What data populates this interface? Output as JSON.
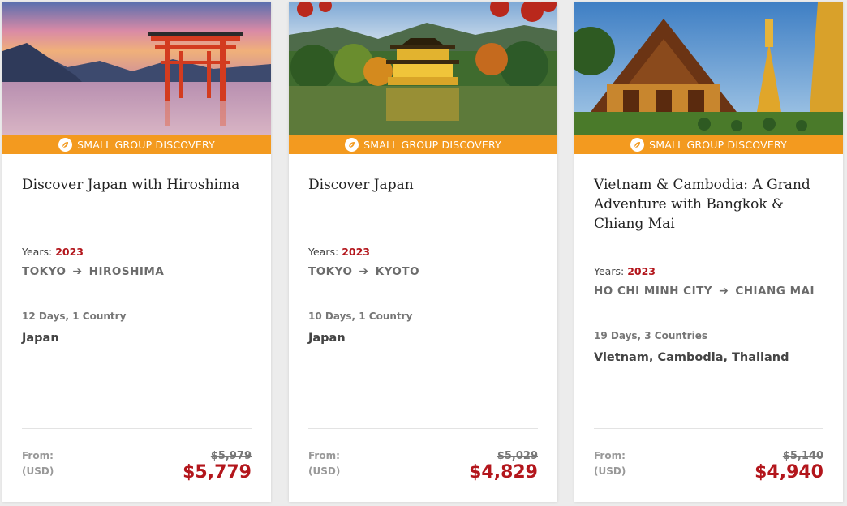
{
  "cards": [
    {
      "banner": "SMALL GROUP DISCOVERY",
      "title": "Discover Japan with Hiroshima",
      "years_label": "Years:",
      "years_value": "2023",
      "route_from": "TOKYO",
      "route_to": "HIROSHIMA",
      "duration": "12 Days, 1 Country",
      "countries": "Japan",
      "from_label": "From:",
      "currency": "(USD)",
      "old_price": "$5,979",
      "price": "$5,779"
    },
    {
      "banner": "SMALL GROUP DISCOVERY",
      "title": "Discover Japan",
      "years_label": "Years:",
      "years_value": "2023",
      "route_from": "TOKYO",
      "route_to": "KYOTO",
      "duration": "10 Days, 1 Country",
      "countries": "Japan",
      "from_label": "From:",
      "currency": "(USD)",
      "old_price": "$5,029",
      "price": "$4,829"
    },
    {
      "banner": "SMALL GROUP DISCOVERY",
      "title": "Vietnam & Cambodia: A Grand Adventure with Bangkok & Chiang Mai",
      "years_label": "Years:",
      "years_value": "2023",
      "route_from": "HO CHI MINH CITY",
      "route_to": "CHIANG MAI",
      "duration": "19 Days, 3 Countries",
      "countries": "Vietnam, Cambodia, Thailand",
      "from_label": "From:",
      "currency": "(USD)",
      "old_price": "$5,140",
      "price": "$4,940"
    }
  ],
  "colors": {
    "banner": "#f39a1f",
    "price": "#b3161c",
    "year": "#b3161c"
  },
  "icons": {
    "banner_icon": "compass-leaf-icon",
    "route_arrow": "arrow-right-icon"
  }
}
